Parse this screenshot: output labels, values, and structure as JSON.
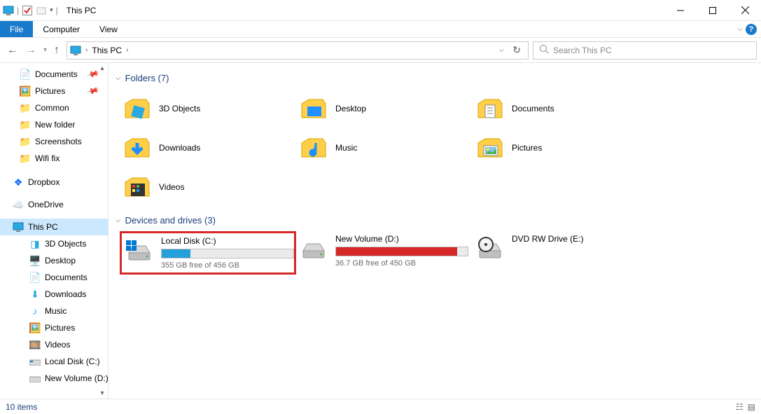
{
  "window": {
    "title": "This PC"
  },
  "ribbon": {
    "tabs": [
      "File",
      "Computer",
      "View"
    ]
  },
  "address": {
    "text": "This PC",
    "separator": "›"
  },
  "search": {
    "placeholder": "Search This PC"
  },
  "sidebar": {
    "pinned": [
      {
        "label": "Documents",
        "icon": "document"
      },
      {
        "label": "Pictures",
        "icon": "picture"
      },
      {
        "label": "Common",
        "icon": "folder"
      },
      {
        "label": "New folder",
        "icon": "folder"
      },
      {
        "label": "Screenshots",
        "icon": "folder"
      },
      {
        "label": "Wifi fix",
        "icon": "folder"
      }
    ],
    "cloud": [
      {
        "label": "Dropbox",
        "color": "#0061ff"
      },
      {
        "label": "OneDrive",
        "color": "#0078d4"
      }
    ],
    "thispc": {
      "label": "This PC",
      "children": [
        {
          "label": "3D Objects"
        },
        {
          "label": "Desktop"
        },
        {
          "label": "Documents"
        },
        {
          "label": "Downloads"
        },
        {
          "label": "Music"
        },
        {
          "label": "Pictures"
        },
        {
          "label": "Videos"
        },
        {
          "label": "Local Disk (C:)"
        },
        {
          "label": "New Volume (D:)"
        }
      ]
    }
  },
  "main": {
    "groups": {
      "folders": {
        "title": "Folders (7)",
        "items": [
          {
            "label": "3D Objects",
            "icon": "3d"
          },
          {
            "label": "Desktop",
            "icon": "desktop"
          },
          {
            "label": "Documents",
            "icon": "document"
          },
          {
            "label": "Downloads",
            "icon": "download"
          },
          {
            "label": "Music",
            "icon": "music"
          },
          {
            "label": "Pictures",
            "icon": "picture"
          },
          {
            "label": "Videos",
            "icon": "video"
          }
        ]
      },
      "drives": {
        "title": "Devices and drives (3)",
        "items": [
          {
            "label": "Local Disk (C:)",
            "free": "355 GB free of 456 GB",
            "fill_pct": 22,
            "fill_color": "#26a0da",
            "highlight": true,
            "type": "hdd"
          },
          {
            "label": "New Volume (D:)",
            "free": "36.7 GB free of 450 GB",
            "fill_pct": 92,
            "fill_color": "#d62828",
            "highlight": false,
            "type": "hdd"
          },
          {
            "label": "DVD RW Drive (E:)",
            "free": "",
            "fill_pct": 0,
            "fill_color": "",
            "highlight": false,
            "type": "dvd"
          }
        ]
      }
    }
  },
  "status": {
    "text": "10 items"
  }
}
